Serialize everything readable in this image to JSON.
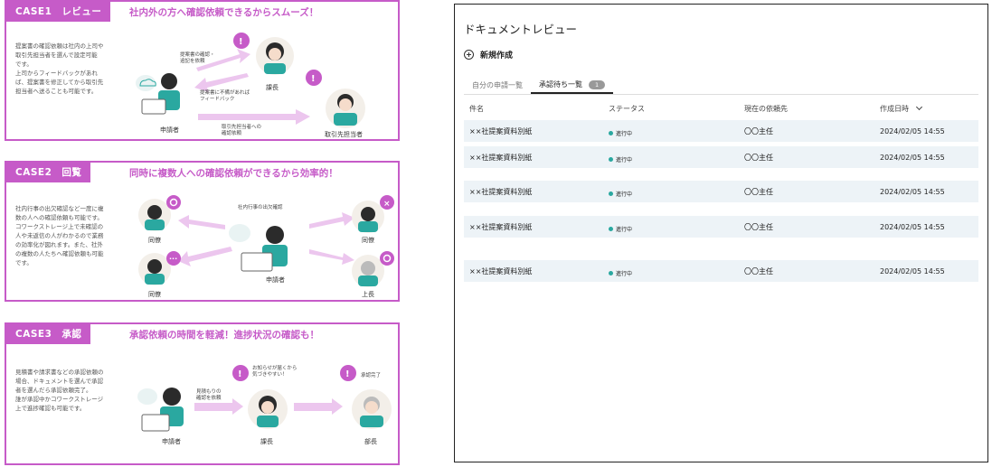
{
  "cases": [
    {
      "tag": "CASE1　レビュー",
      "headline": "社内外の方へ確認依頼できるからスムーズ！",
      "description": "提案書の確認依頼は社内の上司や\n取引先担当者を選んで設定可能\nです。\n上司からフィードバックがあれ\nば、提案書を修正してから取引先\n担当者へ送ることも可能です。",
      "labels": {
        "applicant": "申請者",
        "manager": "課長",
        "client": "取引先担当者",
        "note_confirm": "提案書の確認・\n追記を依頼",
        "note_feedback": "提案書に不備があれば\nフィードバック",
        "note_client": "取引先担当者への\n確認依頼"
      }
    },
    {
      "tag": "CASE2　回覧",
      "headline": "同時に複数人への確認依頼ができるから効率的！",
      "description": "社内行事の出欠確認など一度に複\n数の人への確認依頼も可能です。\nコワークストレージ上で未確認の\n人や未返信の人がわかるので業務\nの効率化が図れます。また、社外\nの複数の人たちへ確認依頼も可能\nです。",
      "labels": {
        "center_note": "社内行事の出欠確認",
        "colleague_1": "同僚",
        "colleague_2": "同僚",
        "colleague_3": "同僚",
        "boss": "上長",
        "applicant": "申請者"
      }
    },
    {
      "tag": "CASE3　承認",
      "headline": "承認依頼の時間を軽減！進捗状況の確認も！",
      "description": "見積書や請求書などの承認依頼の\n場合、ドキュメントを選んで承認\n者を選んだら承認依頼完了。\n誰が承認中かコワークストレージ\n上で進捗確認も可能です。",
      "labels": {
        "applicant": "申請者",
        "manager": "課長",
        "director": "部長",
        "note_estimate": "見積もりの\n確認を依頼",
        "note_notice": "お知らせが届くから\n気づきやすい！",
        "note_done": "承認完了"
      }
    }
  ],
  "panel": {
    "title": "ドキュメントレビュー",
    "new_label": "新規作成",
    "tabs": [
      {
        "label": "自分の申請一覧",
        "active": false
      },
      {
        "label": "承認待ち一覧",
        "active": true,
        "badge": "1"
      }
    ],
    "columns": [
      "件名",
      "ステータス",
      "現在の依頼先",
      "作成日時"
    ],
    "rows": [
      {
        "subject": "××社提案資料別紙",
        "status": "進行中",
        "assignee": "〇〇主任",
        "created": "2024/02/05 14:55"
      },
      {
        "subject": "××社提案資料別紙",
        "status": "進行中",
        "assignee": "〇〇主任",
        "created": "2024/02/05 14:55"
      },
      {
        "subject": "××社提案資料別紙",
        "status": "進行中",
        "assignee": "〇〇主任",
        "created": "2024/02/05 14:55"
      },
      {
        "subject": "××社提案資料別紙",
        "status": "進行中",
        "assignee": "〇〇主任",
        "created": "2024/02/05 14:55"
      },
      {
        "subject": "××社提案資料別紙",
        "status": "進行中",
        "assignee": "〇〇主任",
        "created": "2024/02/05 14:55"
      }
    ]
  },
  "colors": {
    "accent": "#c65bc8",
    "status": "#2aa8a0",
    "row_shade": "#edf3f7"
  }
}
